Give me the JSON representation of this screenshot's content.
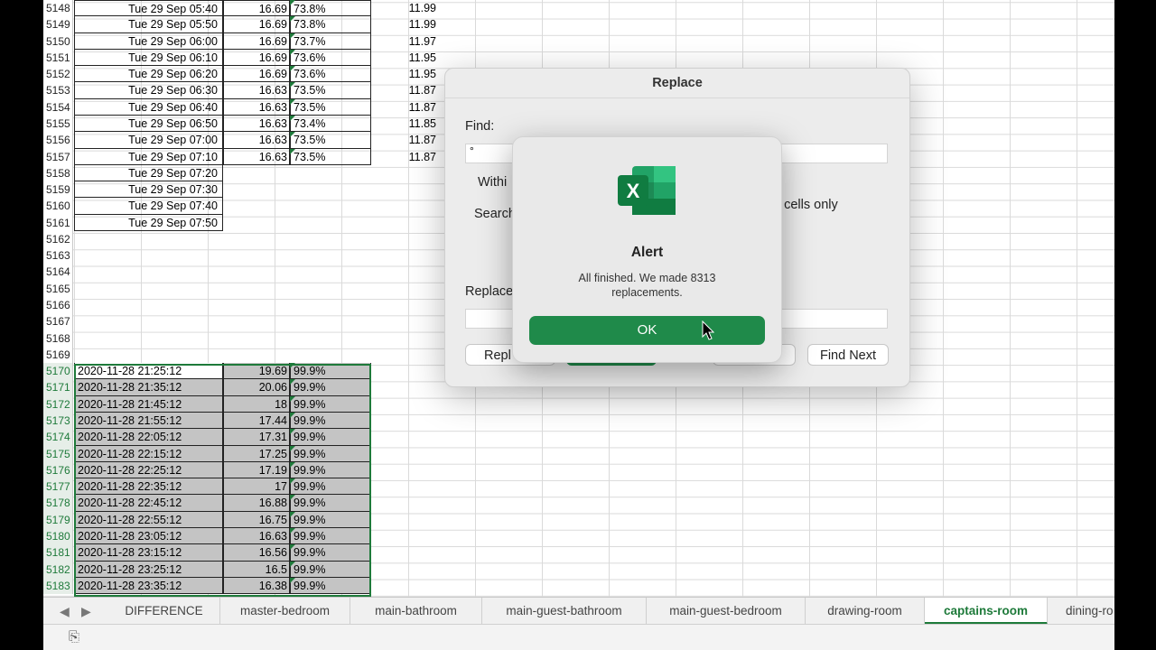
{
  "rows_top": [
    {
      "n": "5148",
      "a": "Tue 29 Sep 05:40",
      "b": "16.69",
      "c": "73.8%",
      "e": "11.99"
    },
    {
      "n": "5149",
      "a": "Tue 29 Sep 05:50",
      "b": "16.69",
      "c": "73.8%",
      "e": "11.99"
    },
    {
      "n": "5150",
      "a": "Tue 29 Sep 06:00",
      "b": "16.69",
      "c": "73.7%",
      "e": "11.97"
    },
    {
      "n": "5151",
      "a": "Tue 29 Sep 06:10",
      "b": "16.69",
      "c": "73.6%",
      "e": "11.95"
    },
    {
      "n": "5152",
      "a": "Tue 29 Sep 06:20",
      "b": "16.69",
      "c": "73.6%",
      "e": "11.95"
    },
    {
      "n": "5153",
      "a": "Tue 29 Sep 06:30",
      "b": "16.63",
      "c": "73.5%",
      "e": "11.87"
    },
    {
      "n": "5154",
      "a": "Tue 29 Sep 06:40",
      "b": "16.63",
      "c": "73.5%",
      "e": "11.87"
    },
    {
      "n": "5155",
      "a": "Tue 29 Sep 06:50",
      "b": "16.63",
      "c": "73.4%",
      "e": "11.85"
    },
    {
      "n": "5156",
      "a": "Tue 29 Sep 07:00",
      "b": "16.63",
      "c": "73.5%",
      "e": "11.87"
    },
    {
      "n": "5157",
      "a": "Tue 29 Sep 07:10",
      "b": "16.63",
      "c": "73.5%",
      "e": "11.87"
    },
    {
      "n": "5158",
      "a": "Tue 29 Sep 07:20",
      "b": "",
      "c": "",
      "e": ""
    },
    {
      "n": "5159",
      "a": "Tue 29 Sep 07:30",
      "b": "",
      "c": "",
      "e": ""
    },
    {
      "n": "5160",
      "a": "Tue 29 Sep 07:40",
      "b": "",
      "c": "",
      "e": ""
    },
    {
      "n": "5161",
      "a": "Tue 29 Sep 07:50",
      "b": "",
      "c": "",
      "e": ""
    }
  ],
  "rows_empty": [
    "5162",
    "5163",
    "5164",
    "5165",
    "5166",
    "5167",
    "5168",
    "5169"
  ],
  "rows_sel": [
    {
      "n": "5170",
      "a": "2020-11-28 21:25:12",
      "b": "19.69",
      "c": "99.9%"
    },
    {
      "n": "5171",
      "a": "2020-11-28 21:35:12",
      "b": "20.06",
      "c": "99.9%"
    },
    {
      "n": "5172",
      "a": "2020-11-28 21:45:12",
      "b": "18",
      "c": "99.9%"
    },
    {
      "n": "5173",
      "a": "2020-11-28 21:55:12",
      "b": "17.44",
      "c": "99.9%"
    },
    {
      "n": "5174",
      "a": "2020-11-28 22:05:12",
      "b": "17.31",
      "c": "99.9%"
    },
    {
      "n": "5175",
      "a": "2020-11-28 22:15:12",
      "b": "17.25",
      "c": "99.9%"
    },
    {
      "n": "5176",
      "a": "2020-11-28 22:25:12",
      "b": "17.19",
      "c": "99.9%"
    },
    {
      "n": "5177",
      "a": "2020-11-28 22:35:12",
      "b": "17",
      "c": "99.9%"
    },
    {
      "n": "5178",
      "a": "2020-11-28 22:45:12",
      "b": "16.88",
      "c": "99.9%"
    },
    {
      "n": "5179",
      "a": "2020-11-28 22:55:12",
      "b": "16.75",
      "c": "99.9%"
    },
    {
      "n": "5180",
      "a": "2020-11-28 23:05:12",
      "b": "16.63",
      "c": "99.9%"
    },
    {
      "n": "5181",
      "a": "2020-11-28 23:15:12",
      "b": "16.56",
      "c": "99.9%"
    },
    {
      "n": "5182",
      "a": "2020-11-28 23:25:12",
      "b": "16.5",
      "c": "99.9%"
    },
    {
      "n": "5183",
      "a": "2020-11-28 23:35:12",
      "b": "16.38",
      "c": "99.9%"
    }
  ],
  "tabs": [
    "DIFFERENCE",
    "master-bedroom",
    "main-bathroom",
    "main-guest-bathroom",
    "main-guest-bedroom",
    "drawing-room",
    "captains-room",
    "dining-ro"
  ],
  "active_tab": "captains-room",
  "replace_dialog": {
    "title": "Replace",
    "find_label": "Find:",
    "find_value": "°",
    "within_label": "Withi",
    "search_label": "Search",
    "match_case_fragment": "e",
    "whole_cells_fragment": "e cells only",
    "replace_label": "Replace",
    "replace_all_fragment": "Repl",
    "find_next_label": "Find Next"
  },
  "alert": {
    "title": "Alert",
    "message": "All finished. We made 8313 replacements.",
    "ok_label": "OK"
  },
  "colors": {
    "excel_green": "#1e7a3a",
    "ok_button": "#1f8a4a",
    "selection": "#c4c4c4"
  },
  "icons": {
    "app": "excel-icon",
    "prev": "chevron-left-icon",
    "next": "chevron-right-icon",
    "status": "sheet-mode-icon"
  }
}
